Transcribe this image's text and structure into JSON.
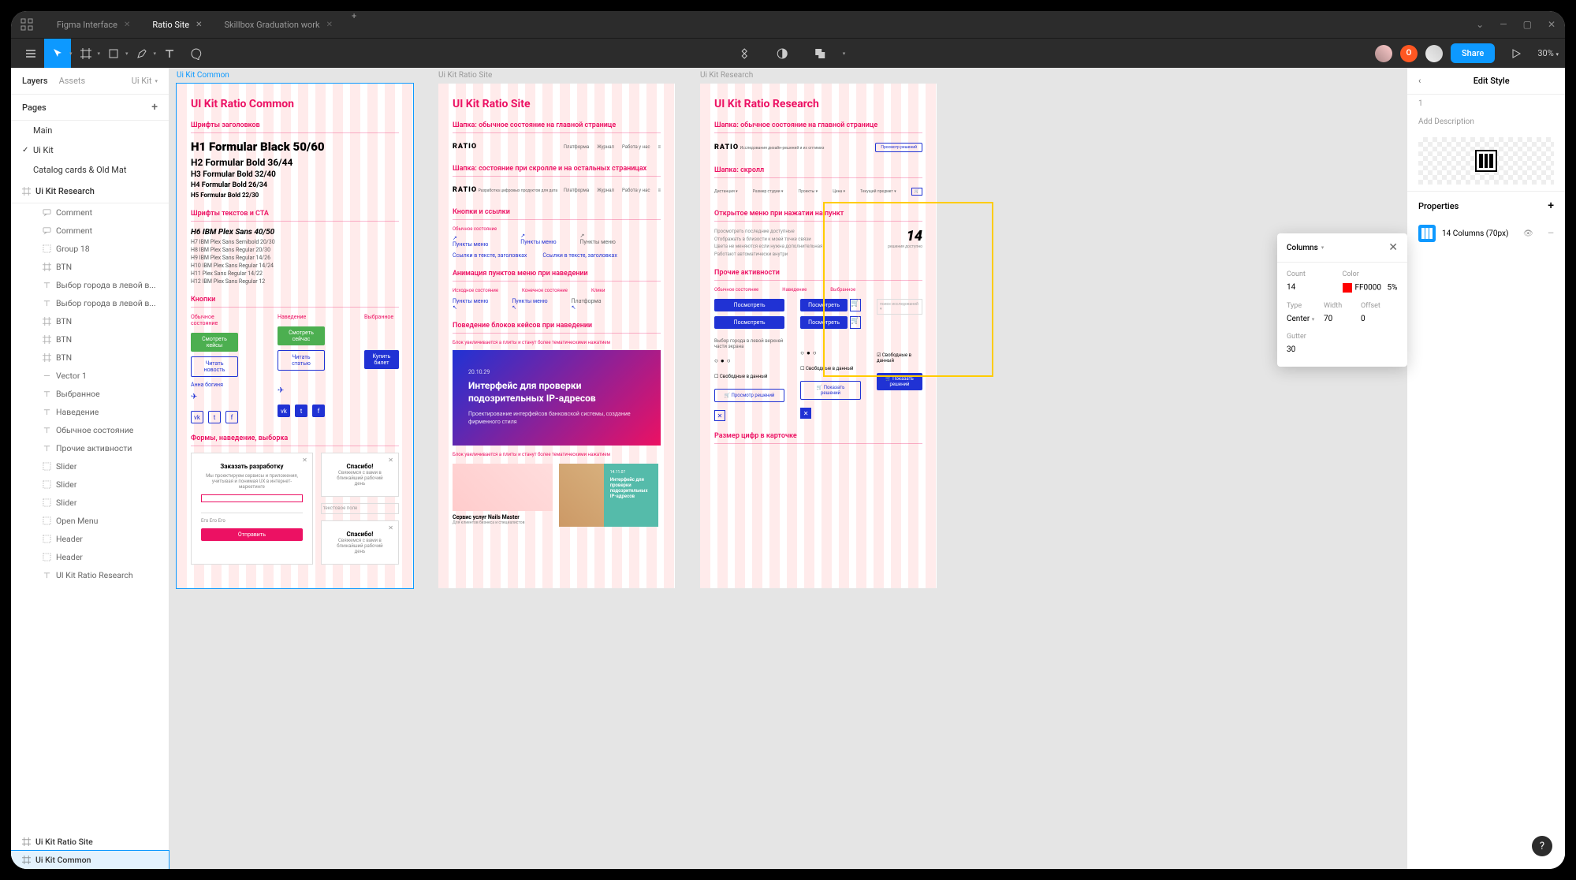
{
  "titlebar": {
    "tabs": [
      {
        "label": "Figma Interface",
        "active": false
      },
      {
        "label": "Ratio Site",
        "active": true
      },
      {
        "label": "Skillbox Graduation work",
        "active": false
      }
    ]
  },
  "toolbar": {
    "share": "Share",
    "zoom": "30%"
  },
  "leftPanel": {
    "tabLayers": "Layers",
    "tabAssets": "Assets",
    "currentPage": "Ui Kit",
    "pagesLabel": "Pages",
    "pages": [
      {
        "label": "Main",
        "checked": false
      },
      {
        "label": "Ui Kit",
        "checked": true
      },
      {
        "label": "Catalog cards & Old Mat",
        "checked": false
      }
    ],
    "frameSection": "Ui Kit Research",
    "layers": [
      {
        "icon": "comment",
        "label": "Comment"
      },
      {
        "icon": "comment",
        "label": "Comment"
      },
      {
        "icon": "group",
        "label": "Group 18"
      },
      {
        "icon": "frame",
        "label": "BTN"
      },
      {
        "icon": "text",
        "label": "Выбор города в левой в..."
      },
      {
        "icon": "text",
        "label": "Выбор города в левой в..."
      },
      {
        "icon": "frame",
        "label": "BTN"
      },
      {
        "icon": "frame",
        "label": "BTN"
      },
      {
        "icon": "frame",
        "label": "BTN"
      },
      {
        "icon": "vector",
        "label": "Vector 1"
      },
      {
        "icon": "text",
        "label": "Выбранное"
      },
      {
        "icon": "text",
        "label": "Наведение"
      },
      {
        "icon": "text",
        "label": "Обычное состояние"
      },
      {
        "icon": "text",
        "label": "Прочие активности"
      },
      {
        "icon": "group",
        "label": "Slider"
      },
      {
        "icon": "group",
        "label": "Slider"
      },
      {
        "icon": "group",
        "label": "Slider"
      },
      {
        "icon": "group",
        "label": "Open Menu"
      },
      {
        "icon": "group",
        "label": "Header"
      },
      {
        "icon": "group",
        "label": "Header"
      },
      {
        "icon": "text",
        "label": "UI Kit Ratio Research"
      }
    ],
    "bottomFrames": [
      {
        "label": "Ui Kit Ratio Site",
        "selected": false
      },
      {
        "label": "Ui Kit Common",
        "selected": true
      }
    ]
  },
  "canvas": {
    "frames": [
      {
        "name": "Ui Kit Common",
        "selected": true,
        "title": "UI Kit Ratio Common",
        "sections": {
          "fonts_headers": "Шрифты заголовков",
          "h1": "H1 Formular Black 50/60",
          "h2": "H2 Formular Bold 36/44",
          "h3": "H3 Formular Bold 32/40",
          "h4": "H4 Formular Bold 26/34",
          "h5": "H5 Formular Bold 22/30",
          "fonts_text": "Шрифты текстов и CTA",
          "h6": "H6 IBM Plex Sans 40/50",
          "t1": "H7 IBM Plex Sans Semibold 20/30",
          "t2": "H8 IBM Plex Sans Regular 20/30",
          "t3": "H9 IBM Plex Sans Regular 14/26",
          "t4": "H10 IBM Plex Sans Regular 14/24",
          "t5": "H11 Plex Sans Regular 14/22",
          "t6": "H12 IBM Plex Sans Regular 12",
          "buttons": "Кнопки",
          "btn_green": "Смотреть кейсы",
          "btn_green2": "Смотреть сейчас",
          "btn_outline1": "Читать новость",
          "btn_outline2": "Читать статью",
          "btn_blue": "Купить билет",
          "col_normal": "Обычное состояние",
          "col_hover": "Наведение",
          "col_selected": "Выбранное",
          "forms": "Формы, наведение, выборка",
          "form_title": "Заказать разработку",
          "form_desc": "Мы проектируем сервисы и приложения, учитывая и понимая UX в интернет-маркетинге",
          "form_thanks": "Спасибо!",
          "form_thanks_desc": "Свяжемся с вами в ближайший рабочий день",
          "form_btn": "Его Его Его"
        }
      },
      {
        "name": "Ui Kit Ratio Site",
        "selected": false,
        "title": "UI Kit Ratio Site",
        "sections": {
          "header_main": "Шапка: обычное состояние на главной странице",
          "header_scroll": "Шапка: состояние при скролле и на остальных страницах",
          "logo": "RATIO",
          "logo_sub": "Разработка цифровых\nпродуктов для дата",
          "nav1": "Платформа",
          "nav2": "Журнал",
          "nav3": "Работа у нас",
          "links": "Кнопки и ссылки",
          "link_normal": "Обычное состояние",
          "link_menu": "Пункты меню",
          "link_menu2": "Пункты меню",
          "link_menu3": "Пункты меню",
          "links_text": "Ссылки в тексте, заголовках",
          "links_text2": "Ссылки в тексте, заголовках",
          "anim": "Анимация пунктов меню при наведении",
          "anim_col1": "Исходное состояние",
          "anim_col2": "Конечное состояние",
          "anim_col3": "Клики",
          "behavior": "Поведение блоков кейсов при наведении",
          "behavior_desc": "Блок увеличивается а плиты и станут более тематическими нажатием",
          "hero_date": "20.10.29",
          "hero_title": "Интерфейс для проверки подозрительных IP-адресов",
          "hero_desc": "Проектирование интерфейсов банковской системы, создание фирменного стиля",
          "case_title": "Сервис услуг Nails Master",
          "case_date": "14.11.07",
          "case_text": "Интерфейс для проверки подозрительных IP-адресов"
        }
      },
      {
        "name": "Ui Kit Research",
        "selected": false,
        "title": "UI Kit Ratio Research",
        "sections": {
          "header_main": "Шапка: обычное состояние на главной странице",
          "logo": "RATIO",
          "logo_sub": "Исследования\nдизайн-решений и их оптимиз",
          "cart_btn": "Просмотр решений",
          "header_scroll": "Шапка: скролл",
          "open_menu": "Открытое меню при нажатии на пункт",
          "big_num": "14",
          "activities": "Прочие активности",
          "act_col1": "Обычное состояние",
          "act_col2": "Наведение",
          "act_col3": "Выбранное",
          "btn_view": "Посмотреть",
          "digit_size": "Размер цифр в карточке"
        }
      }
    ]
  },
  "rightPanel": {
    "title": "Edit Style",
    "nameValue": "1",
    "descPlaceholder": "Add Description",
    "propertiesLabel": "Properties",
    "propName": "14 Columns (70px)"
  },
  "popover": {
    "title": "Columns",
    "count_label": "Count",
    "count": "14",
    "color_label": "Color",
    "color_hex": "FF0000",
    "color_opacity": "5%",
    "type_label": "Type",
    "type": "Center",
    "width_label": "Width",
    "width": "70",
    "offset_label": "Offset",
    "offset": "0",
    "gutter_label": "Gutter",
    "gutter": "30"
  }
}
